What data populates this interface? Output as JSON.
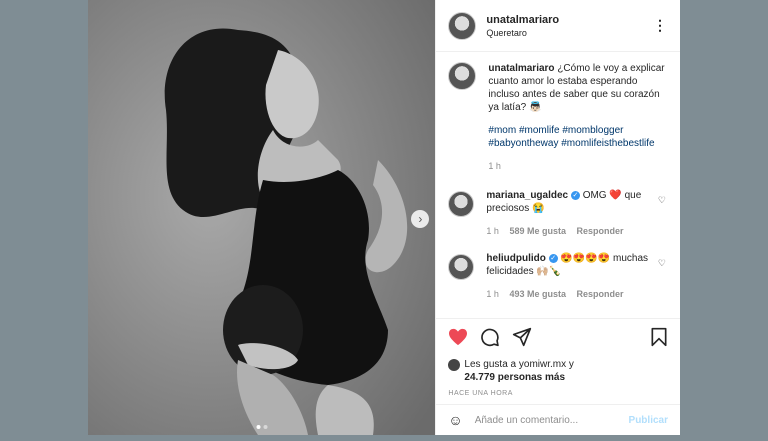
{
  "header": {
    "username": "unatalmariaro",
    "location": "Queretaro",
    "more_icon": "⋮"
  },
  "caption": {
    "username": "unatalmariaro",
    "text": "¿Cómo le voy a explicar cuanto amor lo estaba esperando incluso antes de saber que su corazón ya latía? 👼🏻",
    "tags": "#mom #momlife #momblogger #babyontheway #momlifeisthebestlife",
    "time": "1 h"
  },
  "comments": [
    {
      "username": "mariana_ugaldec",
      "text": "OMG ❤️ que preciosos 😭",
      "time": "1 h",
      "likes": "589 Me gusta",
      "reply": "Responder"
    },
    {
      "username": "heliudpulido",
      "text": "😍😍😍😍 muchas felicidades 🙌🏼🍾",
      "time": "1 h",
      "likes": "493 Me gusta",
      "reply": "Responder"
    }
  ],
  "likes": {
    "text": "Les gusta a yomiwr.mx y",
    "count": "24.779 personas más"
  },
  "posted_ago": "HACE UNA HORA",
  "add_comment": {
    "placeholder": "Añade un comentario...",
    "post_label": "Publicar"
  },
  "colors": {
    "background": "#7f8d94",
    "link": "#00376b",
    "like_red": "#ed4956",
    "post_disabled": "#b2dffc",
    "verified": "#3897f0"
  }
}
